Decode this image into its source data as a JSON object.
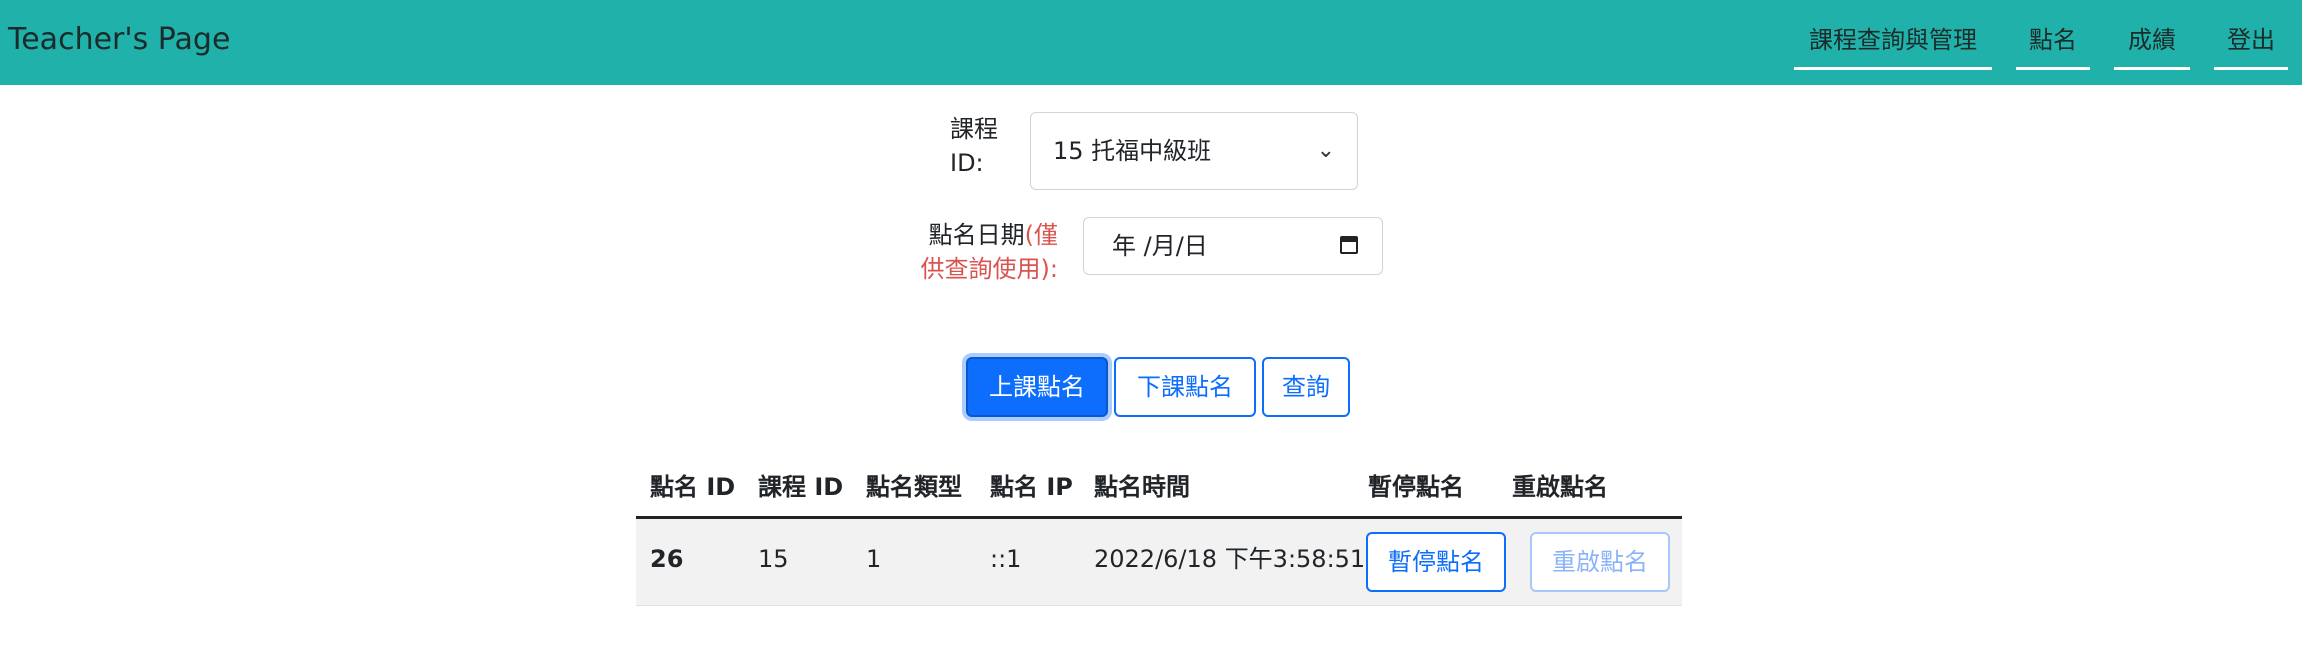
{
  "app": {
    "brand": "Teacher's Page"
  },
  "nav": {
    "items": [
      {
        "label": "課程查詢與管理"
      },
      {
        "label": "點名"
      },
      {
        "label": "成績"
      },
      {
        "label": "登出"
      }
    ]
  },
  "form": {
    "course_label_line1": "課程",
    "course_label_line2": "ID:",
    "course_selected": "15 托福中級班",
    "date_label_line1_a": "點名日期",
    "date_label_line1_b": "(僅",
    "date_label_line2": "供查詢使用):",
    "date_placeholder": "年 /月/日"
  },
  "actions": {
    "checkin_label": "上課點名",
    "checkout_label": "下課點名",
    "query_label": "查詢"
  },
  "table": {
    "headers": [
      "點名 ID",
      "課程 ID",
      "點名類型",
      "點名 IP",
      "點名時間",
      "暫停點名",
      "重啟點名"
    ],
    "rows": [
      {
        "id": "26",
        "course_id": "15",
        "type": "1",
        "ip": "::1",
        "time": "2022/6/18 下午3:58:51",
        "pause_label": "暫停點名",
        "restart_label": "重啟點名"
      }
    ]
  },
  "colors": {
    "navbar": "#20b2aa",
    "primary": "#0d6efd",
    "warning_text": "#d9534f"
  }
}
